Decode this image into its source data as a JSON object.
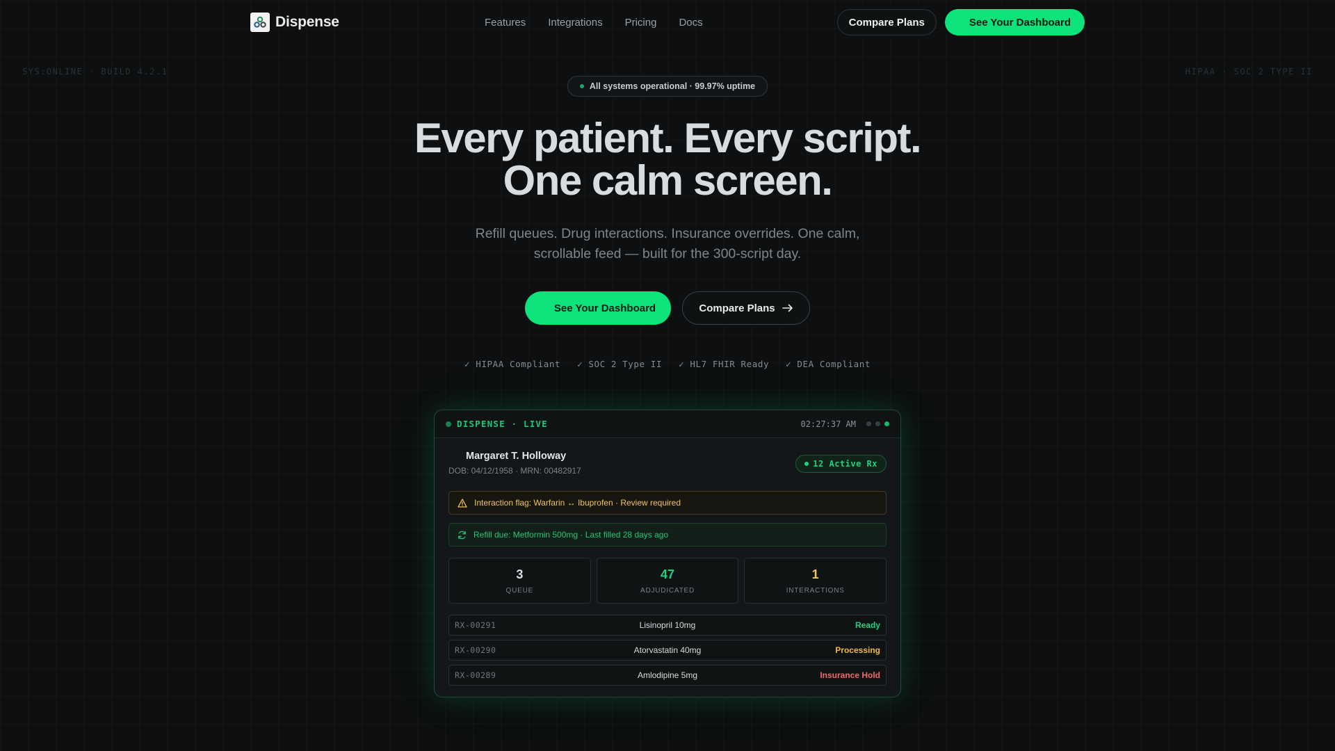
{
  "nav": {
    "brand": "Dispense",
    "links": [
      "Features",
      "Integrations",
      "Pricing",
      "Docs"
    ],
    "compare_label": "Compare Plans",
    "dashboard_label": "See Your Dashboard"
  },
  "corners": {
    "left": "SYS:ONLINE · BUILD 4.2.1",
    "right": "HIPAA · SOC 2 TYPE II"
  },
  "hero": {
    "status": "All systems operational · 99.97% uptime",
    "title_line1": "Every patient. Every script.",
    "title_line2": "One calm screen.",
    "subtitle": "Refill queues. Drug interactions. Insurance overrides. One calm, scrollable feed — built for the 300-script day.",
    "primary_cta": "See Your Dashboard",
    "secondary_cta": "Compare Plans",
    "badges": [
      "✓ HIPAA Compliant",
      "✓ SOC 2 Type II",
      "✓ HL7 FHIR Ready",
      "✓ DEA Compliant"
    ]
  },
  "dashboard": {
    "live_label": "DISPENSE · LIVE",
    "time": "02:27:37 AM",
    "patient": {
      "name": "Margaret T. Holloway",
      "meta": "DOB: 04/12/1958 · MRN: 00482917",
      "active_rx": "12 Active Rx"
    },
    "alerts": {
      "interaction": "Interaction flag: Warfarin ↔ Ibuprofen · Review required",
      "refill": "Refill due: Metformin 500mg · Last filled 28 days ago"
    },
    "stats": [
      {
        "value": "3",
        "label": "QUEUE",
        "color": "#d9dcde"
      },
      {
        "value": "47",
        "label": "ADJUDICATED",
        "color": "#1ed17c"
      },
      {
        "value": "1",
        "label": "INTERACTIONS",
        "color": "#f2c45a"
      }
    ],
    "prescriptions": [
      {
        "id": "RX-00291",
        "drug": "Lisinopril 10mg",
        "status": "Ready",
        "color": "#1ed17c"
      },
      {
        "id": "RX-00290",
        "drug": "Atorvastatin 40mg",
        "status": "Processing",
        "color": "#f2b84a"
      },
      {
        "id": "RX-00289",
        "drug": "Amlodipine 5mg",
        "status": "Insurance Hold",
        "color": "#f06a6a"
      }
    ]
  },
  "colors": {
    "accent": "#0ee27a",
    "background": "#0d0f10"
  }
}
